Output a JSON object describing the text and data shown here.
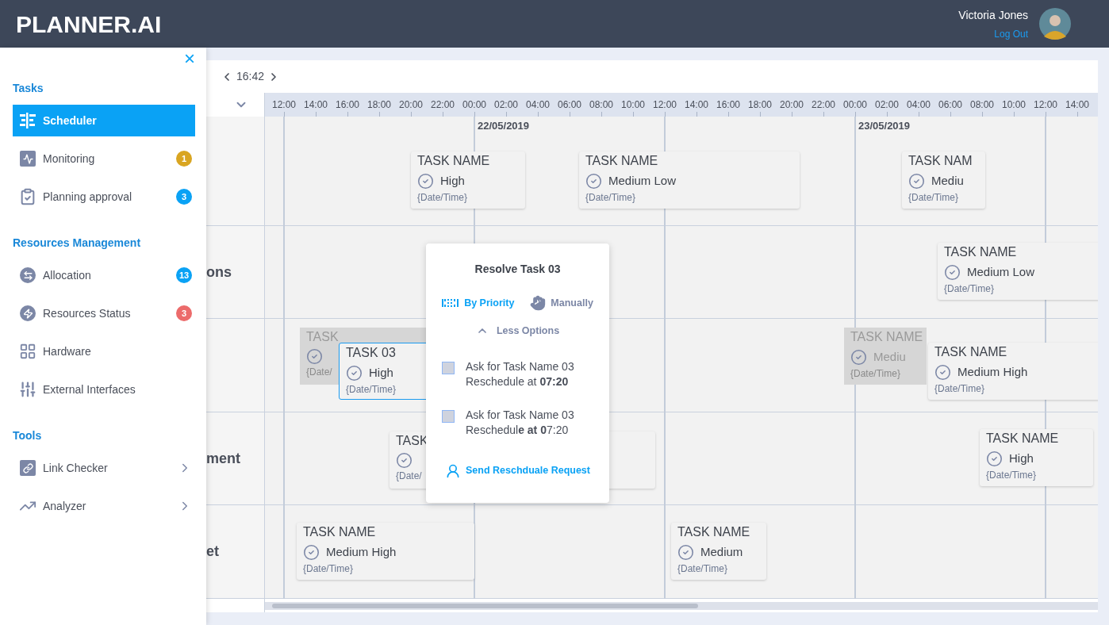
{
  "header": {
    "logo": "PLANNER.AI",
    "user_name": "Victoria Jones",
    "logout": "Log Out"
  },
  "sidebar": {
    "close": "×",
    "sections": [
      {
        "title": "Tasks",
        "items": [
          {
            "label": "Scheduler",
            "selected": true,
            "has_submenu": false
          },
          {
            "label": "Monitoring",
            "selected": false,
            "has_submenu": false,
            "badge": "1",
            "color": "#d9a521"
          },
          {
            "label": "Planning approval",
            "selected": false,
            "has_submenu": false,
            "badge": "3",
            "color": "#0aa2f5"
          }
        ]
      },
      {
        "title": "Resources Management",
        "items": [
          {
            "label": "Allocation",
            "selected": false,
            "has_submenu": false,
            "badge": "13",
            "color": "#0aa2f5"
          },
          {
            "label": "Resources Status",
            "selected": false,
            "has_submenu": false,
            "badge": "3",
            "color": "#ec6b6b"
          },
          {
            "label": "Hardware",
            "selected": false,
            "has_submenu": false
          },
          {
            "label": "External Interfaces",
            "selected": false,
            "has_submenu": false
          }
        ]
      },
      {
        "title": "Tools",
        "items": [
          {
            "label": "Link Checker",
            "selected": false,
            "has_submenu": true
          },
          {
            "label": "Analyzer",
            "selected": false,
            "has_submenu": true
          }
        ]
      }
    ]
  },
  "toolbar": {
    "time": "16:42"
  },
  "timeline": {
    "hours": [
      "12:00",
      "14:00",
      "16:00",
      "18:00",
      "20:00",
      "22:00",
      "00:00",
      "02:00",
      "04:00",
      "06:00",
      "08:00",
      "10:00",
      "12:00",
      "14:00",
      "16:00",
      "18:00",
      "20:00",
      "22:00",
      "00:00",
      "02:00",
      "04:00",
      "06:00",
      "08:00",
      "10:00",
      "12:00",
      "14:00"
    ],
    "days": [
      "22/05/2019",
      "23/05/2019"
    ]
  },
  "lane_labels": [
    "ons",
    "ment",
    "et"
  ],
  "tasks": [
    {
      "kind": "normal",
      "name": "TASK NAME",
      "priority": "High",
      "date": "{Date/Time}"
    },
    {
      "kind": "normal",
      "name": "TASK NAME",
      "priority": "Medium Low",
      "date": "{Date/Time}"
    },
    {
      "kind": "normal",
      "name": "TASK NAM",
      "priority": "Mediu",
      "date": "{Date/Time}"
    },
    {
      "kind": "normal",
      "name": "TASK NAME",
      "priority": "Medium Low",
      "date": "{Date/Time}"
    },
    {
      "kind": "ghost",
      "name": "TASK",
      "date": "{Date/"
    },
    {
      "kind": "selected",
      "name": "TASK 03",
      "priority": "High",
      "date": "{Date/Time}"
    },
    {
      "kind": "ghost",
      "name": "TASK NAME",
      "priority": "Mediu",
      "date": "{Date/Time}"
    },
    {
      "kind": "normal",
      "name": "TASK NAME",
      "priority": "Medium High",
      "date": "{Date/Time}"
    },
    {
      "kind": "normal",
      "name": "TASK",
      "date": "{Date/"
    },
    {
      "kind": "normal",
      "name": "TASK NAME",
      "priority": "High",
      "date": "{Date/Time}"
    },
    {
      "kind": "normal",
      "name": "TASK NAME",
      "priority": "Medium High",
      "date": "{Date/Time}"
    },
    {
      "kind": "normal",
      "name": "TASK NAME",
      "priority": "Medium",
      "date": "{Date/Time}"
    }
  ],
  "popup": {
    "title": "Resolve Task 03",
    "modes": [
      {
        "label": "By Priority",
        "selected": true
      },
      {
        "label": "Manually",
        "selected": false
      }
    ],
    "toggle": "Less Options",
    "options": [
      {
        "text": "Ask for Task Name 03 Reschedule at **07:20**",
        "checked": false
      },
      {
        "text": "Ask for Task Name 03 Reschedul**e at 0**7:20",
        "checked": false
      }
    ],
    "send": "Send Reschduale Request"
  }
}
